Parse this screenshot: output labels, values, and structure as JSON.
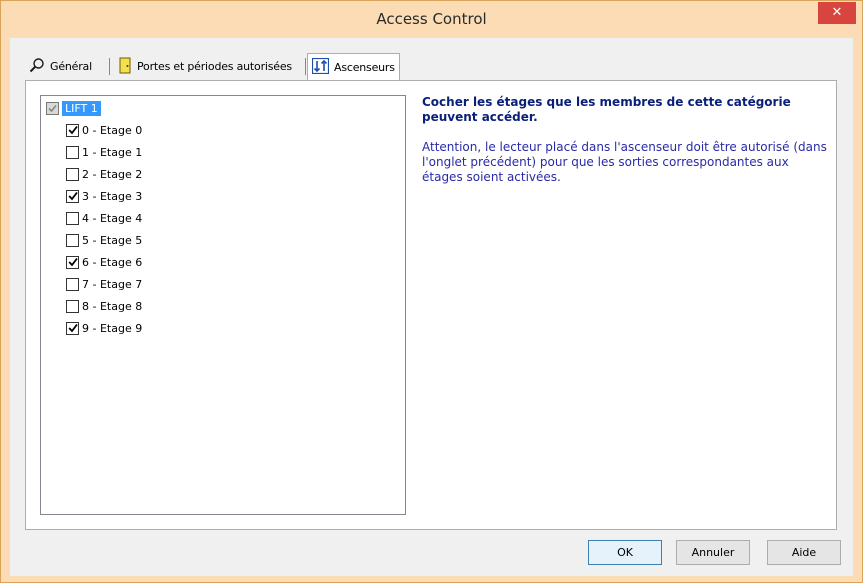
{
  "window": {
    "title": "Access Control",
    "close_glyph": "✕"
  },
  "tabs": [
    {
      "label": "Général",
      "icon": "magnifier-icon"
    },
    {
      "label": "Portes et périodes autorisées",
      "icon": "door-icon"
    },
    {
      "label": "Ascenseurs",
      "icon": "elevator-icon",
      "active": true
    }
  ],
  "tree": {
    "root": {
      "label": "LIFT 1",
      "state": "indeterminate"
    },
    "items": [
      {
        "label": "0 - Etage 0",
        "checked": true
      },
      {
        "label": "1 - Etage 1",
        "checked": false
      },
      {
        "label": "2 - Etage 2",
        "checked": false
      },
      {
        "label": "3 - Etage 3",
        "checked": true
      },
      {
        "label": "4 - Etage 4",
        "checked": false
      },
      {
        "label": "5 - Etage 5",
        "checked": false
      },
      {
        "label": "6 - Etage 6",
        "checked": true
      },
      {
        "label": "7 - Etage 7",
        "checked": false
      },
      {
        "label": "8 - Etage 8",
        "checked": false
      },
      {
        "label": "9 - Etage 9",
        "checked": true
      }
    ]
  },
  "info": {
    "title": "Cocher les étages que les membres de cette catégorie peuvent accéder.",
    "text": "Attention, le lecteur placé dans l'ascenseur doit être autorisé (dans l'onglet précédent) pour que les sorties correspondantes aux étages soient activées."
  },
  "buttons": {
    "ok": "OK",
    "cancel": "Annuler",
    "help": "Aide"
  },
  "colors": {
    "titlebar": "#fbdcb4",
    "close": "#d8453f",
    "selection": "#3399ff",
    "info_title": "#0a1f7a",
    "info_text": "#2a2aa8"
  }
}
